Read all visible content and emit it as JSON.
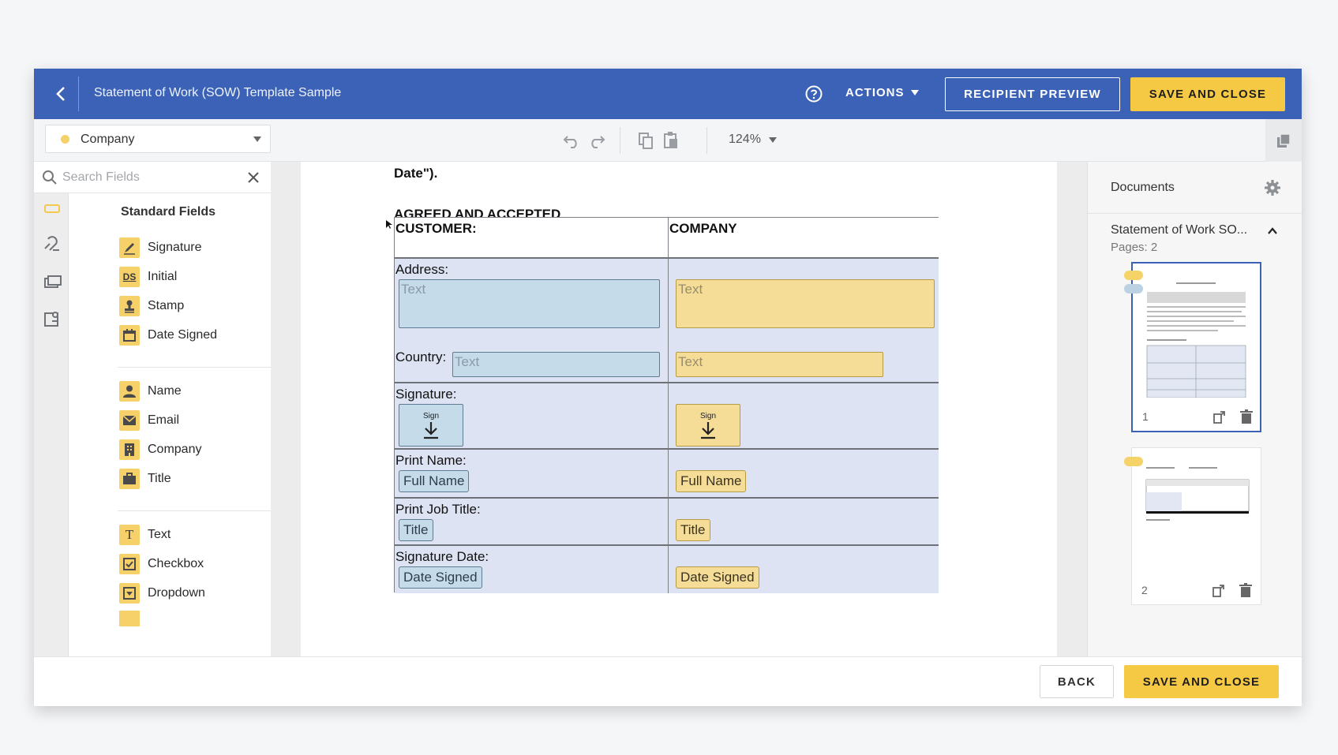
{
  "header": {
    "title": "Statement of Work (SOW) Template Sample",
    "actions_label": "ACTIONS",
    "recipient_preview_label": "RECIPIENT PREVIEW",
    "save_close_label": "SAVE AND CLOSE"
  },
  "toolbar": {
    "recipient": "Company",
    "recipient_color": "#f6d068",
    "zoom": "124%"
  },
  "sidebar": {
    "search_placeholder": "Search Fields",
    "section_title": "Standard Fields",
    "groups": [
      [
        "Signature",
        "Initial",
        "Stamp",
        "Date Signed"
      ],
      [
        "Name",
        "Email",
        "Company",
        "Title"
      ],
      [
        "Text",
        "Checkbox",
        "Dropdown"
      ]
    ],
    "icons": {
      "Signature": "pen-icon",
      "Initial": "initials-icon",
      "Stamp": "stamp-icon",
      "Date Signed": "calendar-icon",
      "Name": "person-icon",
      "Email": "envelope-icon",
      "Company": "building-icon",
      "Title": "briefcase-icon",
      "Text": "text-icon",
      "Checkbox": "checkbox-icon",
      "Dropdown": "dropdown-icon"
    },
    "initial_glyph": "DS",
    "text_glyph": "T"
  },
  "document": {
    "preceding_text": "Date\").",
    "heading": "AGREED AND ACCEPTED",
    "col_customer": "CUSTOMER:",
    "col_company": "COMPANY",
    "address_label": "Address:",
    "country_label": "Country:",
    "signature_label": "Signature:",
    "print_name_label": "Print Name:",
    "print_job_title_label": "Print Job Title:",
    "signature_date_label": "Signature Date:",
    "text_placeholder": "Text",
    "sign_label": "Sign",
    "full_name": "Full Name",
    "title_field": "Title",
    "date_signed": "Date Signed",
    "customer_color": "#c5dbe9",
    "company_color": "#f5dd98"
  },
  "docs_panel": {
    "title": "Documents",
    "doc_name": "Statement of Work SO...",
    "pages": "Pages: 2",
    "page1": "1",
    "page2": "2"
  },
  "footer": {
    "back_label": "BACK",
    "save_close_label": "SAVE AND CLOSE"
  },
  "colors": {
    "header_blue": "#3b62b6",
    "accent_yellow": "#f6c945"
  }
}
